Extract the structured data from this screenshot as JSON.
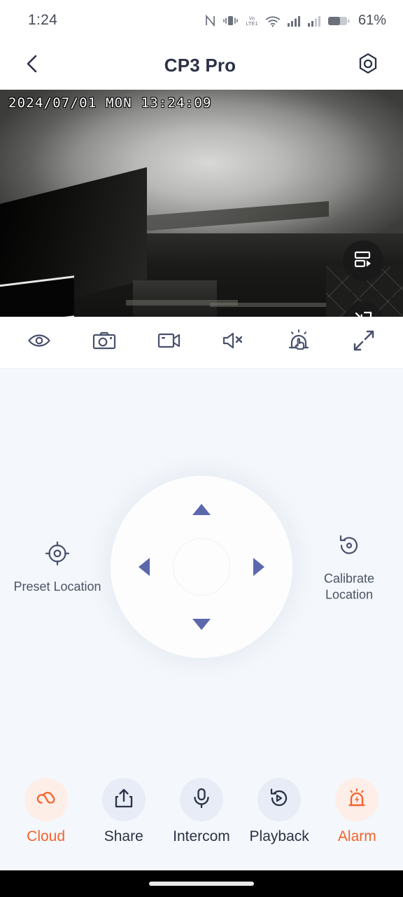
{
  "status_bar": {
    "time": "1:24",
    "battery_percent": "61%",
    "icons": [
      "nfc-icon",
      "vibrate-icon",
      "volte1-icon",
      "wifi-icon",
      "signal-sim1-icon",
      "signal-sim2-icon",
      "battery-icon"
    ]
  },
  "header": {
    "back_icon": "chevron-left-icon",
    "title": "CP3 Pro",
    "settings_icon": "hex-settings-icon"
  },
  "video": {
    "timestamp": "2024/07/01 MON 13:24:09",
    "overlay_buttons": [
      {
        "name": "multi-view-button",
        "icon": "multiview-play-icon"
      },
      {
        "name": "picture-in-picture-button",
        "icon": "pip-minimize-icon"
      }
    ]
  },
  "toolbar": {
    "items": [
      {
        "name": "definition-button",
        "icon": "eye-icon"
      },
      {
        "name": "snapshot-button",
        "icon": "camera-icon"
      },
      {
        "name": "record-button",
        "icon": "video-camera-icon"
      },
      {
        "name": "mute-button",
        "icon": "speaker-muted-icon"
      },
      {
        "name": "siren-button",
        "icon": "siren-hand-icon"
      },
      {
        "name": "fullscreen-button",
        "icon": "expand-arrows-icon"
      }
    ]
  },
  "ptz": {
    "preset": {
      "label": "Preset Location",
      "icon": "crosshair-target-icon"
    },
    "calibrate": {
      "label_line1": "Calibrate",
      "label_line2": "Location",
      "icon": "rotate-calibrate-icon"
    },
    "dpad": {
      "up": "pan-up-arrow",
      "down": "pan-down-arrow",
      "left": "pan-left-arrow",
      "right": "pan-right-arrow"
    }
  },
  "bottom_nav": {
    "items": [
      {
        "label": "Cloud",
        "icon": "cloud-icon",
        "accent": true
      },
      {
        "label": "Share",
        "icon": "share-icon",
        "accent": false
      },
      {
        "label": "Intercom",
        "icon": "microphone-icon",
        "accent": false
      },
      {
        "label": "Playback",
        "icon": "playback-rewind-icon",
        "accent": false
      },
      {
        "label": "Alarm",
        "icon": "siren-alarm-icon",
        "accent": true
      }
    ]
  },
  "colors": {
    "accent_orange": "#f4622b",
    "icon_navy": "#49506b",
    "title_navy": "#2b3146",
    "arrow_blue": "#5b68ab",
    "page_bg": "#f4f7fb",
    "nav_circle_bg": "#e7ecf7",
    "nav_circle_accent_bg": "#fdeee7"
  }
}
